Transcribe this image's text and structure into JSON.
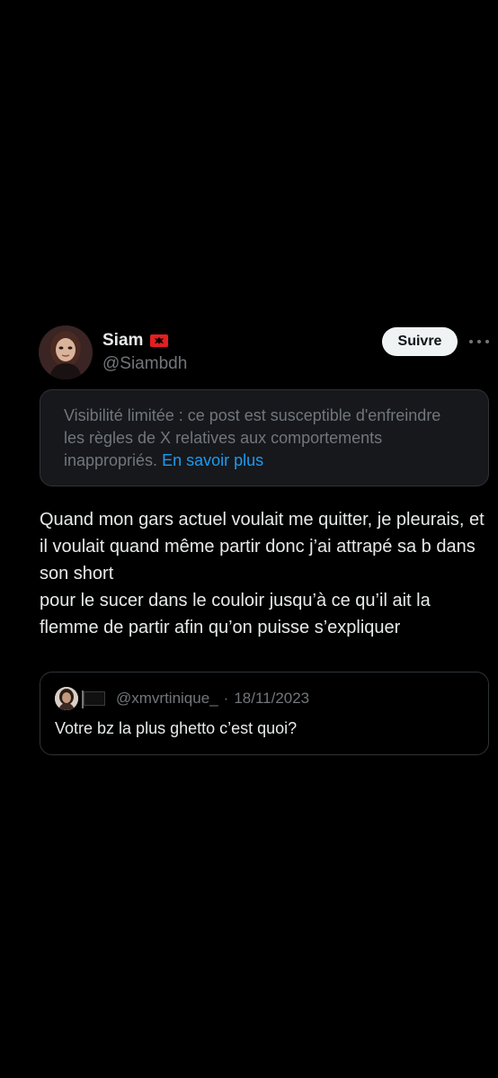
{
  "author": {
    "name": "Siam",
    "flag_icon": "albania-flag-icon",
    "handle": "@Siambdh"
  },
  "actions": {
    "follow_label": "Suivre",
    "more_icon": "more-icon"
  },
  "notice": {
    "text": "Visibilité limitée : ce post est susceptible d'enfreindre les règles de X relatives aux comportements inappropriés.",
    "link": "En savoir plus"
  },
  "tweet": {
    "lines": [
      "Quand mon gars actuel voulait me quitter, je pleurais, et il voulait quand même partir donc j’ai attrapé sa b dans son short",
      "pour le sucer dans le couloir jusqu’à ce qu’il ait la flemme de partir afin qu’on puisse s’expliquer"
    ]
  },
  "quote": {
    "handle": "@xmvrtinique_",
    "separator": "·",
    "date": "18/11/2023",
    "text": "Votre bz la plus ghetto c’est quoi?"
  },
  "colors": {
    "background": "#000000",
    "text_primary": "#e7e9ea",
    "text_secondary": "#71767b",
    "link": "#1d9bf0",
    "border": "#2f3336",
    "notice_bg": "#16181c",
    "follow_bg": "#eff3f4"
  }
}
